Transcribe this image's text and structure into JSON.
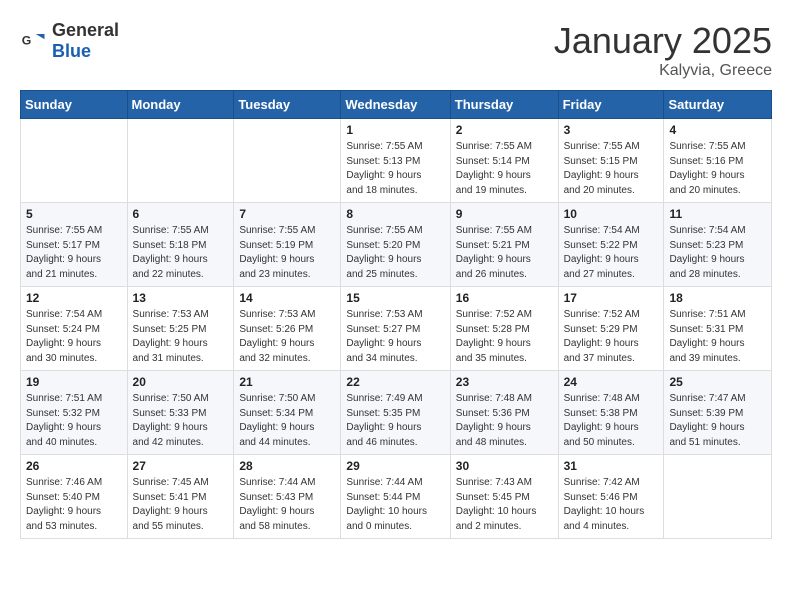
{
  "logo": {
    "general": "General",
    "blue": "Blue"
  },
  "title": "January 2025",
  "location": "Kalyvia, Greece",
  "days_header": [
    "Sunday",
    "Monday",
    "Tuesday",
    "Wednesday",
    "Thursday",
    "Friday",
    "Saturday"
  ],
  "weeks": [
    [
      {
        "day": "",
        "info": ""
      },
      {
        "day": "",
        "info": ""
      },
      {
        "day": "",
        "info": ""
      },
      {
        "day": "1",
        "info": "Sunrise: 7:55 AM\nSunset: 5:13 PM\nDaylight: 9 hours\nand 18 minutes."
      },
      {
        "day": "2",
        "info": "Sunrise: 7:55 AM\nSunset: 5:14 PM\nDaylight: 9 hours\nand 19 minutes."
      },
      {
        "day": "3",
        "info": "Sunrise: 7:55 AM\nSunset: 5:15 PM\nDaylight: 9 hours\nand 20 minutes."
      },
      {
        "day": "4",
        "info": "Sunrise: 7:55 AM\nSunset: 5:16 PM\nDaylight: 9 hours\nand 20 minutes."
      }
    ],
    [
      {
        "day": "5",
        "info": "Sunrise: 7:55 AM\nSunset: 5:17 PM\nDaylight: 9 hours\nand 21 minutes."
      },
      {
        "day": "6",
        "info": "Sunrise: 7:55 AM\nSunset: 5:18 PM\nDaylight: 9 hours\nand 22 minutes."
      },
      {
        "day": "7",
        "info": "Sunrise: 7:55 AM\nSunset: 5:19 PM\nDaylight: 9 hours\nand 23 minutes."
      },
      {
        "day": "8",
        "info": "Sunrise: 7:55 AM\nSunset: 5:20 PM\nDaylight: 9 hours\nand 25 minutes."
      },
      {
        "day": "9",
        "info": "Sunrise: 7:55 AM\nSunset: 5:21 PM\nDaylight: 9 hours\nand 26 minutes."
      },
      {
        "day": "10",
        "info": "Sunrise: 7:54 AM\nSunset: 5:22 PM\nDaylight: 9 hours\nand 27 minutes."
      },
      {
        "day": "11",
        "info": "Sunrise: 7:54 AM\nSunset: 5:23 PM\nDaylight: 9 hours\nand 28 minutes."
      }
    ],
    [
      {
        "day": "12",
        "info": "Sunrise: 7:54 AM\nSunset: 5:24 PM\nDaylight: 9 hours\nand 30 minutes."
      },
      {
        "day": "13",
        "info": "Sunrise: 7:53 AM\nSunset: 5:25 PM\nDaylight: 9 hours\nand 31 minutes."
      },
      {
        "day": "14",
        "info": "Sunrise: 7:53 AM\nSunset: 5:26 PM\nDaylight: 9 hours\nand 32 minutes."
      },
      {
        "day": "15",
        "info": "Sunrise: 7:53 AM\nSunset: 5:27 PM\nDaylight: 9 hours\nand 34 minutes."
      },
      {
        "day": "16",
        "info": "Sunrise: 7:52 AM\nSunset: 5:28 PM\nDaylight: 9 hours\nand 35 minutes."
      },
      {
        "day": "17",
        "info": "Sunrise: 7:52 AM\nSunset: 5:29 PM\nDaylight: 9 hours\nand 37 minutes."
      },
      {
        "day": "18",
        "info": "Sunrise: 7:51 AM\nSunset: 5:31 PM\nDaylight: 9 hours\nand 39 minutes."
      }
    ],
    [
      {
        "day": "19",
        "info": "Sunrise: 7:51 AM\nSunset: 5:32 PM\nDaylight: 9 hours\nand 40 minutes."
      },
      {
        "day": "20",
        "info": "Sunrise: 7:50 AM\nSunset: 5:33 PM\nDaylight: 9 hours\nand 42 minutes."
      },
      {
        "day": "21",
        "info": "Sunrise: 7:50 AM\nSunset: 5:34 PM\nDaylight: 9 hours\nand 44 minutes."
      },
      {
        "day": "22",
        "info": "Sunrise: 7:49 AM\nSunset: 5:35 PM\nDaylight: 9 hours\nand 46 minutes."
      },
      {
        "day": "23",
        "info": "Sunrise: 7:48 AM\nSunset: 5:36 PM\nDaylight: 9 hours\nand 48 minutes."
      },
      {
        "day": "24",
        "info": "Sunrise: 7:48 AM\nSunset: 5:38 PM\nDaylight: 9 hours\nand 50 minutes."
      },
      {
        "day": "25",
        "info": "Sunrise: 7:47 AM\nSunset: 5:39 PM\nDaylight: 9 hours\nand 51 minutes."
      }
    ],
    [
      {
        "day": "26",
        "info": "Sunrise: 7:46 AM\nSunset: 5:40 PM\nDaylight: 9 hours\nand 53 minutes."
      },
      {
        "day": "27",
        "info": "Sunrise: 7:45 AM\nSunset: 5:41 PM\nDaylight: 9 hours\nand 55 minutes."
      },
      {
        "day": "28",
        "info": "Sunrise: 7:44 AM\nSunset: 5:43 PM\nDaylight: 9 hours\nand 58 minutes."
      },
      {
        "day": "29",
        "info": "Sunrise: 7:44 AM\nSunset: 5:44 PM\nDaylight: 10 hours\nand 0 minutes."
      },
      {
        "day": "30",
        "info": "Sunrise: 7:43 AM\nSunset: 5:45 PM\nDaylight: 10 hours\nand 2 minutes."
      },
      {
        "day": "31",
        "info": "Sunrise: 7:42 AM\nSunset: 5:46 PM\nDaylight: 10 hours\nand 4 minutes."
      },
      {
        "day": "",
        "info": ""
      }
    ]
  ]
}
